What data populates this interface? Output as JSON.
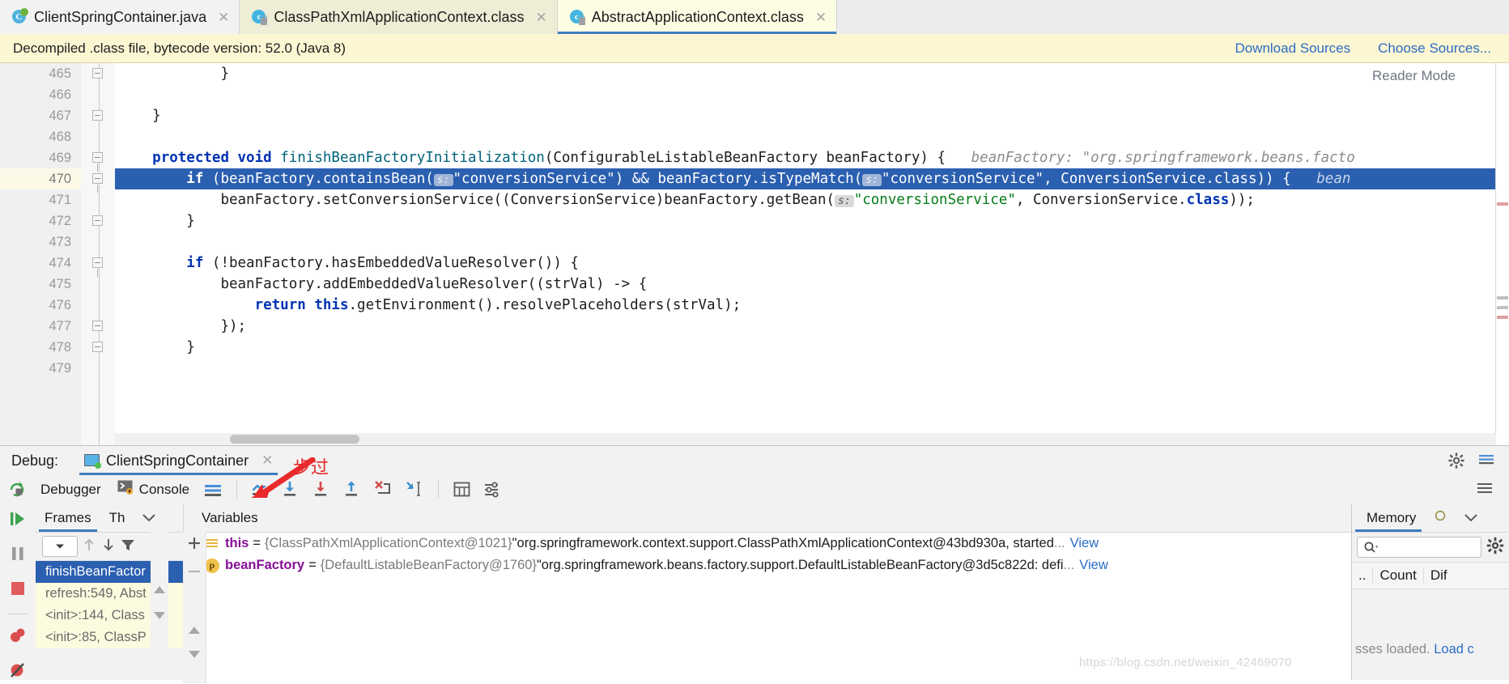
{
  "tabs": [
    {
      "label": "ClientSpringContainer.java",
      "icon": "java-class-icon",
      "state": "inactive",
      "closable": true
    },
    {
      "label": "ClassPathXmlApplicationContext.class",
      "icon": "compiled-class-icon",
      "state": "inactive",
      "closable": true
    },
    {
      "label": "AbstractApplicationContext.class",
      "icon": "compiled-class-icon",
      "state": "active",
      "closable": true
    }
  ],
  "notification": {
    "message": "Decompiled .class file, bytecode version: 52.0 (Java 8)",
    "download_sources": "Download Sources",
    "choose_sources": "Choose Sources...",
    "background": "#fdf6d3",
    "link_color": "#2a6cc4"
  },
  "editor": {
    "reader_mode": "Reader Mode",
    "current_line": 470,
    "selection_color": "#2b5fb0",
    "lines": [
      {
        "number": "465",
        "fold": "close",
        "indent": 2,
        "tokens": [
          {
            "t": "plain",
            "v": "    }"
          }
        ]
      },
      {
        "number": "466",
        "fold": "none",
        "tokens": []
      },
      {
        "number": "467",
        "fold": "close",
        "tokens": [
          {
            "t": "plain",
            "v": "}"
          }
        ]
      },
      {
        "number": "468",
        "fold": "none",
        "tokens": []
      },
      {
        "number": "469",
        "fold": "open",
        "tokens": [
          {
            "t": "kw",
            "v": "protected "
          },
          {
            "t": "kw",
            "v": "void "
          },
          {
            "t": "mth",
            "v": "finishBeanFactoryInitialization"
          },
          {
            "t": "plain",
            "v": "(ConfigurableListableBeanFactory beanFactory) {"
          },
          {
            "t": "inlay",
            "v": "   beanFactory: \"org.springframework.beans.facto"
          }
        ]
      },
      {
        "number": "470",
        "fold": "open",
        "selected": true,
        "tokens": [
          {
            "t": "kw",
            "v": "if"
          },
          {
            "t": "plain",
            "v": " (beanFactory.containsBean("
          },
          {
            "t": "hintbadge",
            "v": "s:"
          },
          {
            "t": "str",
            "v": "\"conversionService\""
          },
          {
            "t": "plain",
            "v": ") && beanFactory.isTypeMatch("
          },
          {
            "t": "hintbadge",
            "v": "s:"
          },
          {
            "t": "str",
            "v": "\"conversionService\""
          },
          {
            "t": "plain",
            "v": ", ConversionService.class)) {"
          },
          {
            "t": "inlay",
            "v": "   bean"
          }
        ]
      },
      {
        "number": "471",
        "fold": "none",
        "tokens": [
          {
            "t": "plain",
            "v": "beanFactory.setConversionService((ConversionService)beanFactory.getBean("
          },
          {
            "t": "hintbadge",
            "v": "s:"
          },
          {
            "t": "str",
            "v": "\"conversionService\""
          },
          {
            "t": "plain",
            "v": ", ConversionService."
          },
          {
            "t": "kw",
            "v": "class"
          },
          {
            "t": "plain",
            "v": "));"
          }
        ]
      },
      {
        "number": "472",
        "fold": "close",
        "tokens": [
          {
            "t": "plain",
            "v": "}"
          }
        ]
      },
      {
        "number": "473",
        "fold": "none",
        "tokens": []
      },
      {
        "number": "474",
        "fold": "open",
        "tokens": [
          {
            "t": "kw",
            "v": "if"
          },
          {
            "t": "plain",
            "v": " (!beanFactory.hasEmbeddedValueResolver()) {"
          }
        ]
      },
      {
        "number": "475",
        "fold": "none",
        "tokens": [
          {
            "t": "plain",
            "v": "beanFactory.addEmbeddedValueResolver((strVal) -> {"
          }
        ]
      },
      {
        "number": "476",
        "fold": "none",
        "tokens": [
          {
            "t": "kw",
            "v": "return "
          },
          {
            "t": "kw",
            "v": "this"
          },
          {
            "t": "plain",
            "v": ".getEnvironment().resolvePlaceholders(strVal);"
          }
        ]
      },
      {
        "number": "477",
        "fold": "close",
        "tokens": [
          {
            "t": "plain",
            "v": "});"
          }
        ]
      },
      {
        "number": "478",
        "fold": "close",
        "tokens": [
          {
            "t": "plain",
            "v": "}"
          }
        ]
      },
      {
        "number": "479",
        "fold": "none",
        "tokens": []
      }
    ]
  },
  "debug": {
    "label": "Debug:",
    "run_config": "ClientSpringContainer",
    "tabs": [
      {
        "label": "Debugger",
        "active": true
      },
      {
        "label": "Console",
        "active": false
      }
    ],
    "toolbar_icons": [
      "show-execution-point-icon",
      "step-over-icon",
      "step-into-icon",
      "force-step-into-icon",
      "step-out-icon",
      "drop-frame-icon",
      "run-to-cursor-icon",
      "evaluate-expression-icon",
      "settings-icon"
    ],
    "left_rail_icons": [
      "resume-program-icon",
      "pause-program-icon",
      "stop-icon",
      "view-breakpoints-icon",
      "mute-breakpoints-icon"
    ],
    "frames": {
      "tab_label": "Frames",
      "threads_tab_label": "Th",
      "items": [
        {
          "label": "finishBeanFactor",
          "selected": true
        },
        {
          "label": "refresh:549, Abst",
          "selected": false
        },
        {
          "label": "<init>:144, Class",
          "selected": false
        },
        {
          "label": "<init>:85, ClassP",
          "selected": false
        }
      ]
    },
    "variables": {
      "tab_label": "Variables",
      "rows": [
        {
          "icon": "field-group-icon",
          "name": "this",
          "eq": "=",
          "type": "{ClassPathXmlApplicationContext@1021}",
          "value": "\"org.springframework.context.support.ClassPathXmlApplicationContext@43bd930a, started",
          "ellipsis": "...",
          "view_link": "View"
        },
        {
          "icon": "parameter-icon",
          "name": "beanFactory",
          "eq": "=",
          "type": "{DefaultListableBeanFactory@1760}",
          "value": "\"org.springframework.beans.factory.support.DefaultListableBeanFactory@3d5c822d: defi",
          "ellipsis": "...",
          "view_link": "View"
        }
      ]
    },
    "memory": {
      "tab_label": "Memory",
      "search_placeholder": "",
      "columns": [
        "..",
        "Count",
        "Dif"
      ],
      "footer_text": "sses loaded.",
      "footer_link": "Load c"
    }
  },
  "annotation": {
    "text": "步过",
    "color": "#e8262a",
    "arrow": "step-over-pointer-arrow"
  },
  "watermark": "https://blog.csdn.net/weixin_42469070"
}
